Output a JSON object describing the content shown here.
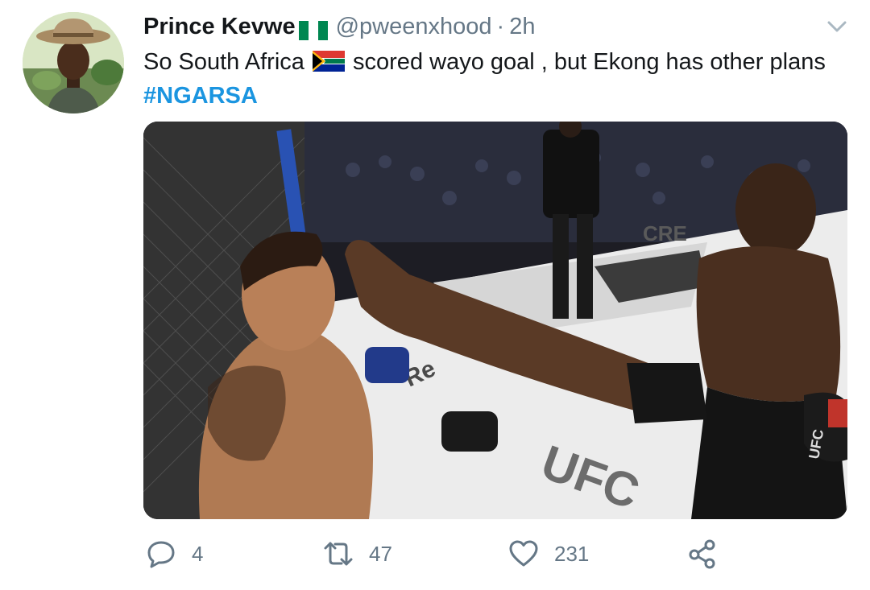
{
  "tweet": {
    "author_name": "Prince Kevwe",
    "author_handle": "@pweenxhood",
    "separator": "·",
    "timestamp": "2h",
    "text_part1": "So South Africa",
    "text_part2": " scored wayo goal , but Ekong has other plans ",
    "hashtag": "#NGARSA",
    "author_flag_icon": "nigeria-flag-emoji",
    "inline_flag_icon": "south-africa-flag-emoji",
    "hashtag_color": "#1b95e0"
  },
  "media": {
    "octagon_sign": "CRE",
    "mat_text_bottom": "UFC",
    "mat_text_partial": "Re",
    "glove_text": "UFC"
  },
  "actions": {
    "reply_count": "4",
    "retweet_count": "47",
    "like_count": "231",
    "icon_color": "#657786"
  }
}
